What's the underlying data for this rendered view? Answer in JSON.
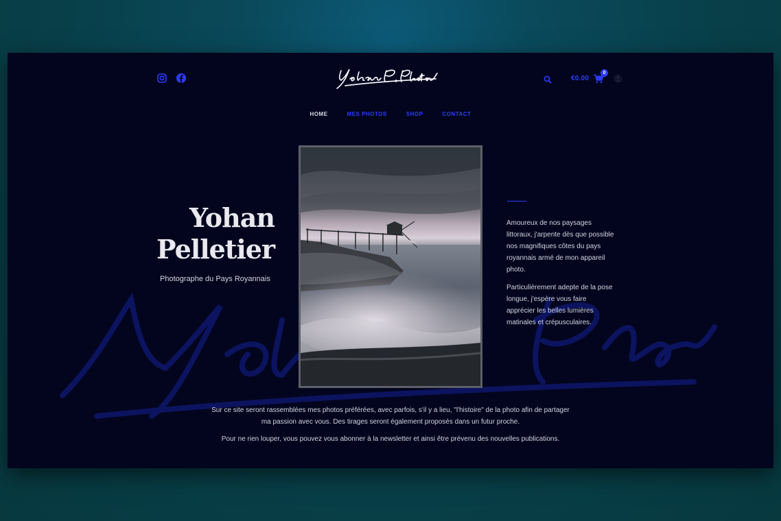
{
  "header": {
    "logo_text": "Yohan P. Photos",
    "cart_total": "€0.00",
    "cart_count": "0"
  },
  "nav": {
    "items": [
      "HOME",
      "MES PHOTOS",
      "SHOP",
      "CONTACT"
    ],
    "active": "HOME"
  },
  "hero": {
    "name_line1": "Yohan",
    "name_line2": "Pelletier",
    "subtitle": "Photographe du Pays Royannais"
  },
  "bio": {
    "paragraph1": "Amoureux de nos paysages littoraux, j'arpente dès que possible nos magnifiques côtes du pays royannais armé de mon appareil photo.",
    "paragraph2": " Particulièrement adepte de la pose longue, j'espère vous faire apprécier les belles lumières matinales et crépusculaires."
  },
  "intro": {
    "line1": "Sur ce site seront rassemblées mes photos préférées, avec parfois, s'il y a lieu, \"l'histoire\" de la photo afin de partager",
    "line2": "ma passion avec vous. Des tirages seront également proposés dans un futur proche.",
    "paragraph2": "Pour ne rien louper, vous pouvez vous abonner à la newsletter et ainsi être prévenu des nouvelles publications."
  },
  "colors": {
    "background": "#03051e",
    "accent": "#2a3cff",
    "text": "#d2d4de",
    "heading": "#e8e8ee"
  },
  "icons": [
    "instagram-icon",
    "facebook-icon",
    "search-icon",
    "cart-icon",
    "user-icon"
  ]
}
